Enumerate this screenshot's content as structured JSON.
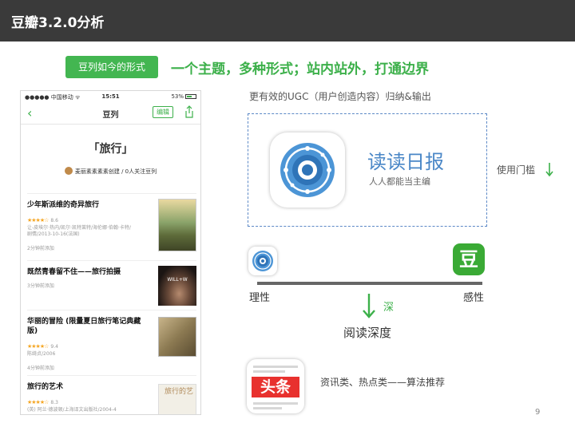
{
  "header": {
    "title": "豆瓣3.2.0分析"
  },
  "section": {
    "tag": "豆列如今的形式",
    "headline": "一个主题，多种形式；站内站外，打通边界"
  },
  "phone": {
    "status": {
      "carrier": "●●●●● 中国移动 ᯤ",
      "time": "15:51",
      "battery": "53%"
    },
    "nav": {
      "back": "‹",
      "title": "豆列",
      "edit_label": "编辑"
    },
    "list_title": "「旅行」",
    "creator": "麦丽素素素素创建 / 0人关注豆列",
    "items": [
      {
        "title": "少年斯派维的奇异旅行",
        "stars": "★★★★☆",
        "score": "8.6",
        "meta1": "让-皮埃尔·热内/凯尔·凯特莱特/海伦娜·伯翰·卡特/",
        "meta2": "剧情/2013-10-16(法国)",
        "time": "2分钟前添加"
      },
      {
        "title": "既然青春留不住——旅行拍摄",
        "time": "3分钟前添加",
        "cover_text": "WILL+W"
      },
      {
        "title": "华丽的冒险 (限量夏日旅行笔记典藏版)",
        "stars": "★★★★☆",
        "score": "9.4",
        "meta1": "陈绮贞/2006",
        "time": "4分钟前添加"
      },
      {
        "title": "旅行的艺术",
        "stars": "★★★★☆",
        "score": "8.3",
        "meta1": "(英) 阿兰·德波顿/上海译文出版社/2004-4",
        "cover_text": "旅行的艺"
      }
    ]
  },
  "right": {
    "subtitle": "更有效的UGC（用户创造内容）归纳&输出",
    "app_name": "读读日报",
    "app_slogan": "人人都能当主编",
    "threshold": "使用门槛",
    "dou_icon": "豆",
    "scale_left": "理性",
    "scale_right": "感性",
    "deep": "深",
    "depth": "阅读深度",
    "toutiao_icon": "头条",
    "news": "资讯类、热点类——算法推荐"
  },
  "page_number": "9",
  "colors": {
    "accent_green": "#43b651",
    "blue": "#4a87c7",
    "dark_header": "#3a3a3a",
    "toutiao_red": "#e8312e"
  },
  "icons": [
    "back-chevron-icon",
    "share-icon",
    "reading-daily-app-icon",
    "douban-app-icon",
    "toutiao-app-icon",
    "down-arrow-icon"
  ]
}
